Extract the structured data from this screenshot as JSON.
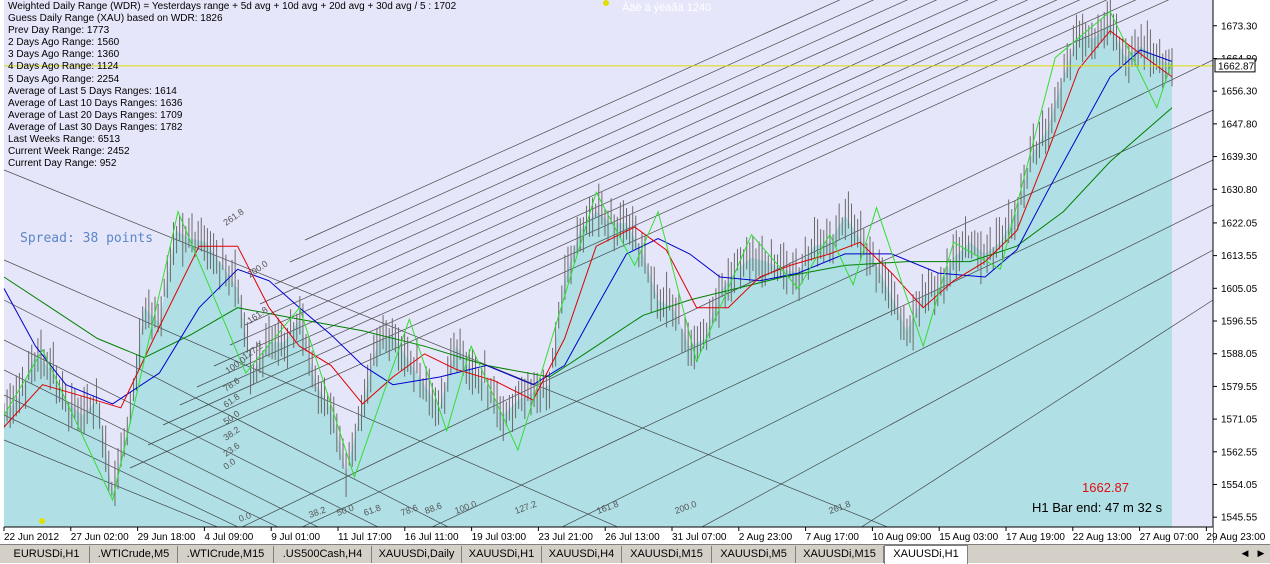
{
  "info_lines": [
    "Weighted Daily Range (WDR) = Yesterdays range + 5d avg + 10d avg + 20d avg + 30d avg / 5 : 1702",
    "Guess Daily Range (XAU) based on WDR: 1826",
    "Prev Day Range: 1773",
    "2 Days Ago Range: 1560",
    "3 Days Ago Range: 1360",
    "4 Days Ago Range: 1124",
    "5 Days Ago Range: 2254",
    "Average of Last 5 Days Ranges: 1614",
    "Average of Last 10 Days Ranges: 1636",
    "Average of Last 20 Days Ranges: 1709",
    "Average of Last 30 Days Ranges: 1782",
    "Last Weeks Range: 6513",
    "Current Week Range: 2452",
    "Current Day Range: 952"
  ],
  "hidden_label": "Àäë ä ýëäãä 1240",
  "spread_text": "Spread: 38 points",
  "current_price_label": "1662.87",
  "bar_end_text": "H1 Bar end: 47 m 32 s",
  "fib_labels_upper": [
    "261.8",
    "200.0",
    "161.8",
    "127.2",
    "100.0",
    "78.6",
    "61.8",
    "50.0",
    "38.2",
    "23.6",
    "0.0"
  ],
  "fib_labels_lower": [
    "0.0",
    "38.2",
    "50.0",
    "61.8",
    "78.6",
    "88.6",
    "100.0",
    "127.2",
    "161.8",
    "200.0",
    "261.8"
  ],
  "colors": {
    "background": "#e6e6fa",
    "area_fill": "#b0e0e6",
    "candle": "#6a6a6a",
    "ma_fast": "#e00000",
    "ma_mid": "#0000cc",
    "ma_slow": "#008000",
    "zigzag": "#33dd33",
    "price_line": "#dddd00",
    "fan_line": "#2a2a2a"
  },
  "tabs": [
    {
      "label": "EURUSDi,H1",
      "active": false
    },
    {
      "label": ".WTICrude,M5",
      "active": false
    },
    {
      "label": ".WTICrude,M15",
      "active": false
    },
    {
      "label": ".US500Cash,H4",
      "active": false
    },
    {
      "label": "XAUUSDi,Daily",
      "active": false
    },
    {
      "label": "XAUUSDi,H1",
      "active": false
    },
    {
      "label": "XAUUSDi,H4",
      "active": false
    },
    {
      "label": "XAUUSDi,M15",
      "active": false
    },
    {
      "label": "XAUUSDi,M5",
      "active": false
    },
    {
      "label": "XAUUSDi,M15",
      "active": false
    },
    {
      "label": "XAUUSDi,H1",
      "active": true
    }
  ],
  "chart_data": {
    "type": "candlestick",
    "symbol": "",
    "y_range": [
      1543.0,
      1680.0
    ],
    "y_axis_ticks": [
      "1673.30",
      "1664.80",
      "1656.30",
      "1647.80",
      "1639.30",
      "1630.80",
      "1622.05",
      "1613.55",
      "1605.05",
      "1596.55",
      "1588.05",
      "1579.55",
      "1571.05",
      "1562.55",
      "1554.05",
      "1545.55"
    ],
    "y_axis_tick_values": [
      1673.3,
      1664.8,
      1656.3,
      1647.8,
      1639.3,
      1630.8,
      1622.05,
      1613.55,
      1605.05,
      1596.55,
      1588.05,
      1579.55,
      1571.05,
      1562.55,
      1554.05,
      1545.55
    ],
    "x_axis_ticks": [
      "22 Jun 2012",
      "27 Jun 02:00",
      "29 Jun 18:00",
      "4 Jul 09:00",
      "9 Jul 01:00",
      "11 Jul 17:00",
      "16 Jul 11:00",
      "19 Jul 03:00",
      "23 Jul 21:00",
      "26 Jul 13:00",
      "31 Jul 07:00",
      "2 Aug 23:00",
      "7 Aug 17:00",
      "10 Aug 09:00",
      "15 Aug 03:00",
      "17 Aug 19:00",
      "22 Aug 13:00",
      "27 Aug 07:00",
      "29 Aug 23:00"
    ],
    "current_price": 1662.87,
    "current_price_text": "1662.87",
    "price_path": [
      {
        "x": 0.0,
        "y": 1572
      },
      {
        "x": 0.013,
        "y": 1577
      },
      {
        "x": 0.027,
        "y": 1588
      },
      {
        "x": 0.04,
        "y": 1584
      },
      {
        "x": 0.053,
        "y": 1576
      },
      {
        "x": 0.067,
        "y": 1572
      },
      {
        "x": 0.08,
        "y": 1576
      },
      {
        "x": 0.093,
        "y": 1552
      },
      {
        "x": 0.107,
        "y": 1570
      },
      {
        "x": 0.12,
        "y": 1600
      },
      {
        "x": 0.133,
        "y": 1596
      },
      {
        "x": 0.147,
        "y": 1620
      },
      {
        "x": 0.16,
        "y": 1618
      },
      {
        "x": 0.173,
        "y": 1617
      },
      {
        "x": 0.187,
        "y": 1611
      },
      {
        "x": 0.2,
        "y": 1605
      },
      {
        "x": 0.213,
        "y": 1583
      },
      {
        "x": 0.227,
        "y": 1591
      },
      {
        "x": 0.24,
        "y": 1591
      },
      {
        "x": 0.253,
        "y": 1597
      },
      {
        "x": 0.267,
        "y": 1580
      },
      {
        "x": 0.28,
        "y": 1574
      },
      {
        "x": 0.293,
        "y": 1557
      },
      {
        "x": 0.307,
        "y": 1575
      },
      {
        "x": 0.32,
        "y": 1591
      },
      {
        "x": 0.333,
        "y": 1593
      },
      {
        "x": 0.347,
        "y": 1586
      },
      {
        "x": 0.36,
        "y": 1580
      },
      {
        "x": 0.373,
        "y": 1574
      },
      {
        "x": 0.387,
        "y": 1590
      },
      {
        "x": 0.4,
        "y": 1584
      },
      {
        "x": 0.413,
        "y": 1580
      },
      {
        "x": 0.427,
        "y": 1572
      },
      {
        "x": 0.44,
        "y": 1576
      },
      {
        "x": 0.453,
        "y": 1578
      },
      {
        "x": 0.467,
        "y": 1580
      },
      {
        "x": 0.48,
        "y": 1607
      },
      {
        "x": 0.493,
        "y": 1620
      },
      {
        "x": 0.507,
        "y": 1625
      },
      {
        "x": 0.52,
        "y": 1622
      },
      {
        "x": 0.533,
        "y": 1622
      },
      {
        "x": 0.547,
        "y": 1614
      },
      {
        "x": 0.56,
        "y": 1602
      },
      {
        "x": 0.573,
        "y": 1600
      },
      {
        "x": 0.587,
        "y": 1590
      },
      {
        "x": 0.6,
        "y": 1592
      },
      {
        "x": 0.613,
        "y": 1604
      },
      {
        "x": 0.627,
        "y": 1610
      },
      {
        "x": 0.64,
        "y": 1613
      },
      {
        "x": 0.653,
        "y": 1612
      },
      {
        "x": 0.667,
        "y": 1610
      },
      {
        "x": 0.68,
        "y": 1609
      },
      {
        "x": 0.693,
        "y": 1616
      },
      {
        "x": 0.707,
        "y": 1617
      },
      {
        "x": 0.72,
        "y": 1624
      },
      {
        "x": 0.733,
        "y": 1618
      },
      {
        "x": 0.747,
        "y": 1611
      },
      {
        "x": 0.76,
        "y": 1603
      },
      {
        "x": 0.773,
        "y": 1594
      },
      {
        "x": 0.787,
        "y": 1603
      },
      {
        "x": 0.8,
        "y": 1605
      },
      {
        "x": 0.813,
        "y": 1613
      },
      {
        "x": 0.827,
        "y": 1617
      },
      {
        "x": 0.84,
        "y": 1614
      },
      {
        "x": 0.853,
        "y": 1617
      },
      {
        "x": 0.867,
        "y": 1625
      },
      {
        "x": 0.88,
        "y": 1640
      },
      {
        "x": 0.893,
        "y": 1646
      },
      {
        "x": 0.907,
        "y": 1660
      },
      {
        "x": 0.92,
        "y": 1671
      },
      {
        "x": 0.933,
        "y": 1670
      },
      {
        "x": 0.947,
        "y": 1674
      },
      {
        "x": 0.96,
        "y": 1665
      },
      {
        "x": 0.973,
        "y": 1668
      },
      {
        "x": 0.987,
        "y": 1665
      },
      {
        "x": 1.0,
        "y": 1662.87
      }
    ],
    "zigzag_points": [
      {
        "x": 0.0,
        "y": 1572
      },
      {
        "x": 0.033,
        "y": 1589
      },
      {
        "x": 0.093,
        "y": 1550
      },
      {
        "x": 0.149,
        "y": 1625
      },
      {
        "x": 0.207,
        "y": 1583
      },
      {
        "x": 0.253,
        "y": 1600
      },
      {
        "x": 0.3,
        "y": 1556
      },
      {
        "x": 0.347,
        "y": 1597
      },
      {
        "x": 0.379,
        "y": 1568
      },
      {
        "x": 0.4,
        "y": 1590
      },
      {
        "x": 0.44,
        "y": 1563
      },
      {
        "x": 0.507,
        "y": 1630
      },
      {
        "x": 0.54,
        "y": 1611
      },
      {
        "x": 0.56,
        "y": 1625
      },
      {
        "x": 0.593,
        "y": 1586
      },
      {
        "x": 0.64,
        "y": 1619
      },
      {
        "x": 0.68,
        "y": 1605
      },
      {
        "x": 0.707,
        "y": 1619
      },
      {
        "x": 0.727,
        "y": 1606
      },
      {
        "x": 0.747,
        "y": 1626
      },
      {
        "x": 0.787,
        "y": 1590
      },
      {
        "x": 0.813,
        "y": 1617
      },
      {
        "x": 0.853,
        "y": 1610
      },
      {
        "x": 0.9,
        "y": 1665
      },
      {
        "x": 0.947,
        "y": 1677
      },
      {
        "x": 0.987,
        "y": 1652
      },
      {
        "x": 1.0,
        "y": 1664
      }
    ],
    "ma_fast": [
      {
        "x": 0.0,
        "y": 1569
      },
      {
        "x": 0.033,
        "y": 1580
      },
      {
        "x": 0.067,
        "y": 1577
      },
      {
        "x": 0.1,
        "y": 1574
      },
      {
        "x": 0.133,
        "y": 1595
      },
      {
        "x": 0.167,
        "y": 1616
      },
      {
        "x": 0.2,
        "y": 1616
      },
      {
        "x": 0.227,
        "y": 1600
      },
      {
        "x": 0.253,
        "y": 1590
      },
      {
        "x": 0.28,
        "y": 1585
      },
      {
        "x": 0.307,
        "y": 1575
      },
      {
        "x": 0.333,
        "y": 1582
      },
      {
        "x": 0.36,
        "y": 1588
      },
      {
        "x": 0.387,
        "y": 1584
      },
      {
        "x": 0.42,
        "y": 1581
      },
      {
        "x": 0.453,
        "y": 1576
      },
      {
        "x": 0.48,
        "y": 1592
      },
      {
        "x": 0.507,
        "y": 1616
      },
      {
        "x": 0.54,
        "y": 1621
      },
      {
        "x": 0.567,
        "y": 1615
      },
      {
        "x": 0.593,
        "y": 1600
      },
      {
        "x": 0.62,
        "y": 1600
      },
      {
        "x": 0.647,
        "y": 1608
      },
      {
        "x": 0.673,
        "y": 1611
      },
      {
        "x": 0.707,
        "y": 1614
      },
      {
        "x": 0.733,
        "y": 1617
      },
      {
        "x": 0.76,
        "y": 1609
      },
      {
        "x": 0.787,
        "y": 1600
      },
      {
        "x": 0.813,
        "y": 1607
      },
      {
        "x": 0.84,
        "y": 1612
      },
      {
        "x": 0.867,
        "y": 1620
      },
      {
        "x": 0.893,
        "y": 1640
      },
      {
        "x": 0.92,
        "y": 1662
      },
      {
        "x": 0.947,
        "y": 1672
      },
      {
        "x": 0.973,
        "y": 1666
      },
      {
        "x": 1.0,
        "y": 1660
      }
    ],
    "ma_mid": [
      {
        "x": 0.0,
        "y": 1605
      },
      {
        "x": 0.027,
        "y": 1590
      },
      {
        "x": 0.053,
        "y": 1580
      },
      {
        "x": 0.093,
        "y": 1575
      },
      {
        "x": 0.133,
        "y": 1583
      },
      {
        "x": 0.167,
        "y": 1600
      },
      {
        "x": 0.2,
        "y": 1610
      },
      {
        "x": 0.227,
        "y": 1607
      },
      {
        "x": 0.253,
        "y": 1600
      },
      {
        "x": 0.28,
        "y": 1593
      },
      {
        "x": 0.307,
        "y": 1585
      },
      {
        "x": 0.333,
        "y": 1580
      },
      {
        "x": 0.373,
        "y": 1582
      },
      {
        "x": 0.413,
        "y": 1585
      },
      {
        "x": 0.453,
        "y": 1580
      },
      {
        "x": 0.48,
        "y": 1585
      },
      {
        "x": 0.507,
        "y": 1600
      },
      {
        "x": 0.533,
        "y": 1614
      },
      {
        "x": 0.56,
        "y": 1618
      },
      {
        "x": 0.587,
        "y": 1614
      },
      {
        "x": 0.613,
        "y": 1608
      },
      {
        "x": 0.647,
        "y": 1607
      },
      {
        "x": 0.68,
        "y": 1609
      },
      {
        "x": 0.72,
        "y": 1614
      },
      {
        "x": 0.76,
        "y": 1614
      },
      {
        "x": 0.8,
        "y": 1609
      },
      {
        "x": 0.84,
        "y": 1608
      },
      {
        "x": 0.867,
        "y": 1615
      },
      {
        "x": 0.893,
        "y": 1630
      },
      {
        "x": 0.92,
        "y": 1645
      },
      {
        "x": 0.947,
        "y": 1660
      },
      {
        "x": 0.973,
        "y": 1667
      },
      {
        "x": 1.0,
        "y": 1664
      }
    ],
    "ma_slow": [
      {
        "x": 0.0,
        "y": 1608
      },
      {
        "x": 0.04,
        "y": 1600
      },
      {
        "x": 0.08,
        "y": 1592
      },
      {
        "x": 0.12,
        "y": 1587
      },
      {
        "x": 0.16,
        "y": 1593
      },
      {
        "x": 0.2,
        "y": 1600
      },
      {
        "x": 0.253,
        "y": 1597
      },
      {
        "x": 0.307,
        "y": 1594
      },
      {
        "x": 0.36,
        "y": 1590
      },
      {
        "x": 0.413,
        "y": 1585
      },
      {
        "x": 0.467,
        "y": 1582
      },
      {
        "x": 0.507,
        "y": 1590
      },
      {
        "x": 0.547,
        "y": 1598
      },
      {
        "x": 0.587,
        "y": 1602
      },
      {
        "x": 0.627,
        "y": 1605
      },
      {
        "x": 0.667,
        "y": 1608
      },
      {
        "x": 0.72,
        "y": 1611
      },
      {
        "x": 0.773,
        "y": 1612
      },
      {
        "x": 0.827,
        "y": 1612
      },
      {
        "x": 0.867,
        "y": 1616
      },
      {
        "x": 0.907,
        "y": 1625
      },
      {
        "x": 0.947,
        "y": 1638
      },
      {
        "x": 1.0,
        "y": 1652
      }
    ]
  }
}
